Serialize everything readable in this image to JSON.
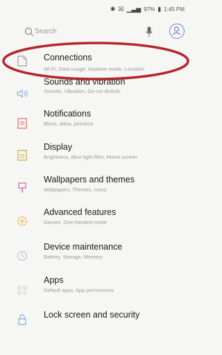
{
  "status_bar": {
    "battery": "97%",
    "time": "1:45 PM"
  },
  "search": {
    "placeholder": "Search"
  },
  "colors": {
    "highlight": "#b3262b",
    "accent": "#5b6fd0"
  },
  "settings_items": [
    {
      "title": "Connections",
      "subtitle": "Wi-Fi, Data usage, Airplane mode, Location",
      "icon": "connections-icon"
    },
    {
      "title": "Sounds and vibration",
      "subtitle": "Sounds, Vibration, Do not disturb",
      "icon": "speaker-icon"
    },
    {
      "title": "Notifications",
      "subtitle": "Block, allow, prioritize",
      "icon": "notifications-icon"
    },
    {
      "title": "Display",
      "subtitle": "Brightness, Blue light filter, Home screen",
      "icon": "display-icon"
    },
    {
      "title": "Wallpapers and themes",
      "subtitle": "Wallpapers, Themes, Icons",
      "icon": "brush-icon"
    },
    {
      "title": "Advanced features",
      "subtitle": "Games, One-handed mode",
      "icon": "gear-plus-icon"
    },
    {
      "title": "Device maintenance",
      "subtitle": "Battery, Storage, Memory",
      "icon": "maintenance-icon"
    },
    {
      "title": "Apps",
      "subtitle": "Default apps, App permissions",
      "icon": "apps-icon"
    },
    {
      "title": "Lock screen and security",
      "subtitle": "",
      "icon": "lock-icon"
    }
  ]
}
